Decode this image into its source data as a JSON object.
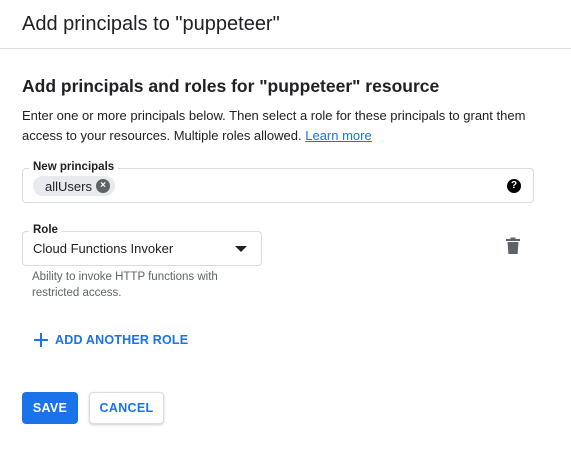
{
  "header": {
    "title": "Add principals to \"puppeteer\""
  },
  "section": {
    "title": "Add principals and roles for \"puppeteer\" resource",
    "description": "Enter one or more principals below. Then select a role for these principals to grant them access to your resources. Multiple roles allowed. ",
    "learn_more": "Learn more"
  },
  "principals": {
    "label": "New principals",
    "chips": [
      "allUsers"
    ],
    "remove_icon": "cancel-circle-icon",
    "help_icon": "help-circle-icon"
  },
  "role": {
    "label": "Role",
    "selected": "Cloud Functions Invoker",
    "hint": "Ability to invoke HTTP functions with restricted access.",
    "delete_icon": "trash-icon"
  },
  "actions": {
    "add_role": "ADD ANOTHER ROLE",
    "save": "SAVE",
    "cancel": "CANCEL"
  },
  "colors": {
    "primary": "#1a73e8",
    "text": "#202124",
    "secondary_text": "#5f6368",
    "border": "#dadce0",
    "chip_bg": "#e8eaed"
  }
}
